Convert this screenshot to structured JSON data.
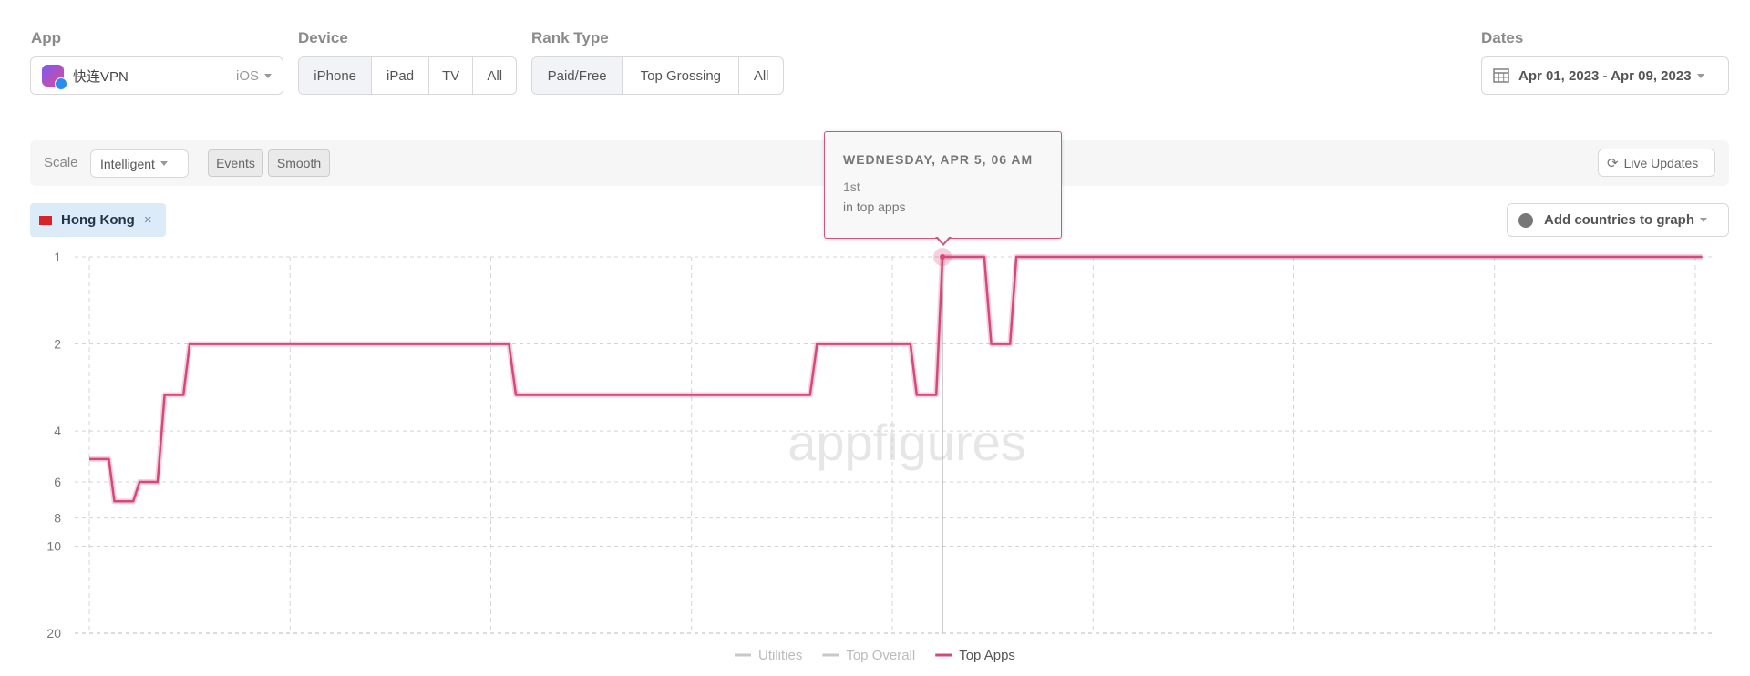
{
  "filters": {
    "app": {
      "label": "App",
      "name": "快连VPN",
      "platform": "iOS"
    },
    "device": {
      "label": "Device",
      "options": [
        "iPhone",
        "iPad",
        "TV",
        "All"
      ],
      "selected": "iPhone"
    },
    "rank_type": {
      "label": "Rank Type",
      "options": [
        "Paid/Free",
        "Top Grossing",
        "All"
      ],
      "selected": "Paid/Free"
    },
    "dates": {
      "label": "Dates",
      "value": "Apr 01, 2023 - Apr 09, 2023"
    }
  },
  "toolbar": {
    "scale_label": "Scale",
    "scale_value": "Intelligent",
    "events_label": "Events",
    "smooth_label": "Smooth",
    "live_updates_label": "Live Updates"
  },
  "countries": {
    "selected": [
      {
        "name": "Hong Kong"
      }
    ],
    "add_label": "Add countries to graph"
  },
  "tooltip": {
    "title": "WEDNESDAY, APR 5, 06 AM",
    "rank": "1st",
    "subtitle": "in top apps"
  },
  "watermark": "appfigures",
  "colors": {
    "accent": "#d6477a",
    "legend_inactive": "#c8c8c8"
  },
  "chart_data": {
    "type": "line",
    "y_scale": "log",
    "y_reversed": true,
    "ylim": [
      1,
      20
    ],
    "yticks": [
      "1",
      "2",
      "4",
      "6",
      "8",
      "10",
      "20"
    ],
    "xlim": [
      "2023-04-01 00:00",
      "2023-04-09 00:00"
    ],
    "grid": true,
    "legend_placement": "bottom",
    "hover": {
      "x": "2023-04-05 06:00",
      "y": 1
    },
    "series": [
      {
        "name": "Utilities",
        "color": "#c8c8c8",
        "points": []
      },
      {
        "name": "Top Overall",
        "color": "#c8c8c8",
        "points": []
      },
      {
        "name": "Top Apps",
        "color": "#d6477a",
        "points": [
          [
            "2023-04-01 00:00",
            5
          ],
          [
            "2023-04-01 02:20",
            5
          ],
          [
            "2023-04-01 03:00",
            7
          ],
          [
            "2023-04-01 05:15",
            7
          ],
          [
            "2023-04-01 06:00",
            6
          ],
          [
            "2023-04-01 08:10",
            6
          ],
          [
            "2023-04-01 09:00",
            3
          ],
          [
            "2023-04-01 11:15",
            3
          ],
          [
            "2023-04-01 12:00",
            2
          ],
          [
            "2023-04-03 02:10",
            2
          ],
          [
            "2023-04-03 03:00",
            3
          ],
          [
            "2023-04-04 14:10",
            3
          ],
          [
            "2023-04-04 15:00",
            2
          ],
          [
            "2023-04-05 02:10",
            2
          ],
          [
            "2023-04-05 02:55",
            3
          ],
          [
            "2023-04-05 05:15",
            3
          ],
          [
            "2023-04-05 06:00",
            1
          ],
          [
            "2023-04-05 11:00",
            1
          ],
          [
            "2023-04-05 11:50",
            2
          ],
          [
            "2023-04-05 14:05",
            2
          ],
          [
            "2023-04-05 14:50",
            1
          ],
          [
            "2023-04-09 00:50",
            1
          ]
        ]
      }
    ]
  }
}
